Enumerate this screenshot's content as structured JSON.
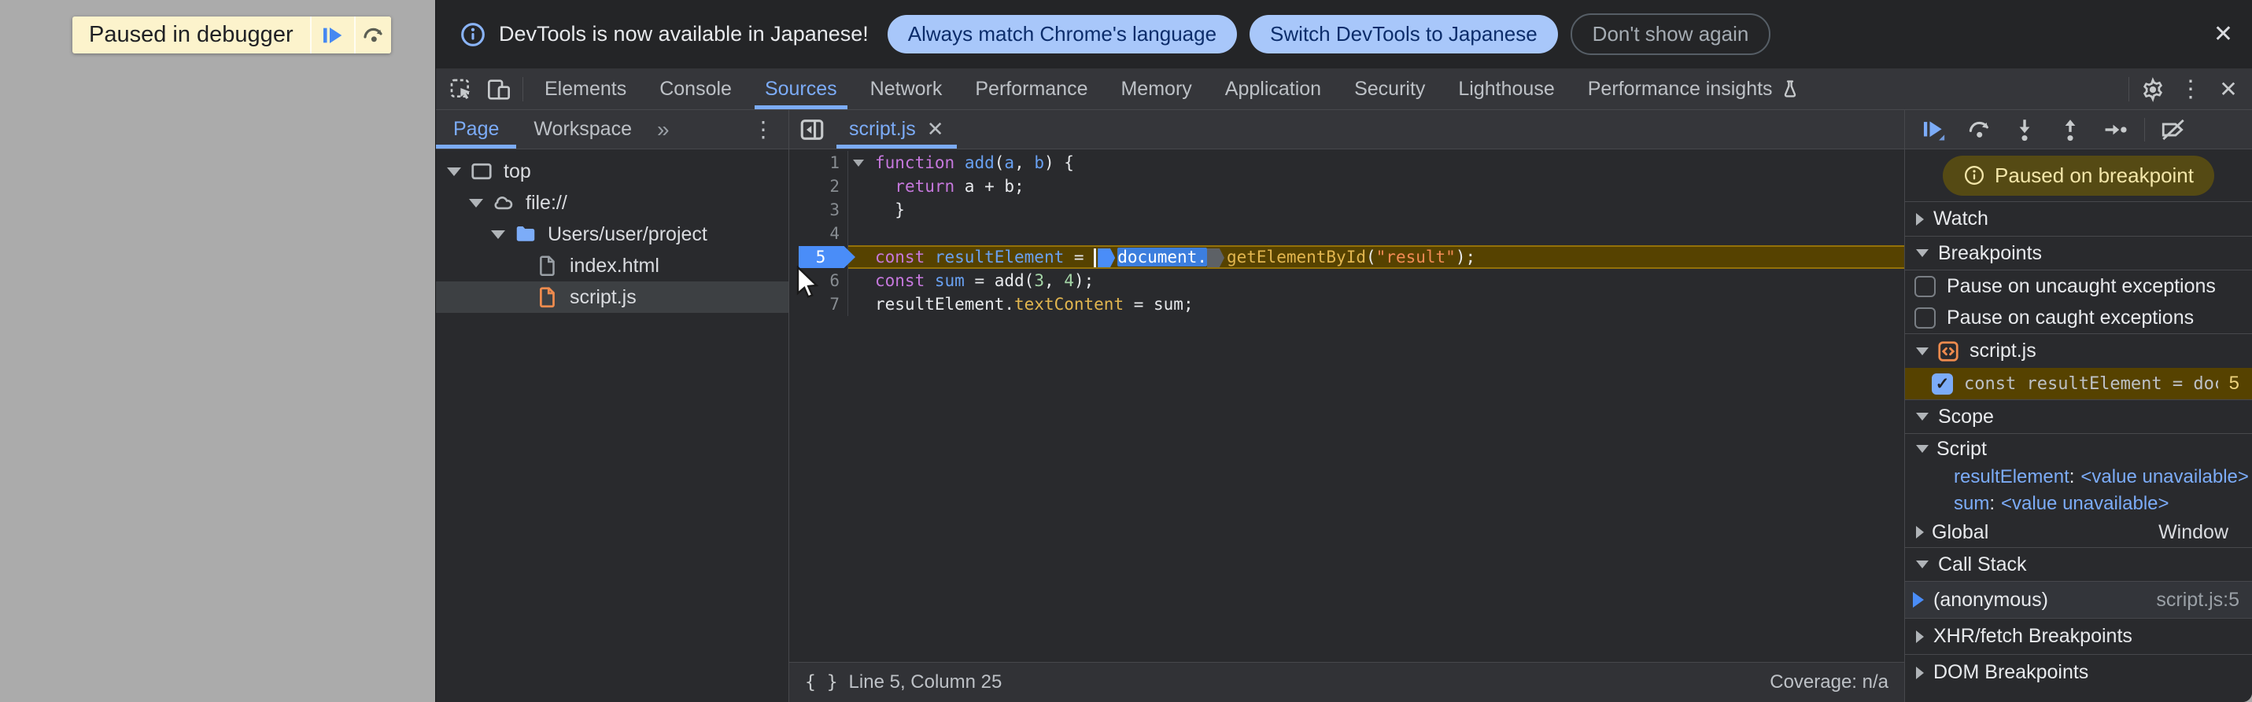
{
  "page_overlay": {
    "paused_label": "Paused in debugger"
  },
  "infobar": {
    "message": "DevTools is now available in Japanese!",
    "buttons": [
      {
        "label": "Always match Chrome's language",
        "style": "filled"
      },
      {
        "label": "Switch DevTools to Japanese",
        "style": "filled"
      },
      {
        "label": "Don't show again",
        "style": "outline"
      }
    ],
    "close_label": "✕"
  },
  "tabbar": {
    "tabs": [
      "Elements",
      "Console",
      "Sources",
      "Network",
      "Performance",
      "Memory",
      "Application",
      "Security",
      "Lighthouse",
      "Performance insights"
    ],
    "active": "Sources",
    "flask_tab": "Performance insights"
  },
  "navigator": {
    "tabs": [
      {
        "label": "Page",
        "active": true
      },
      {
        "label": "Workspace",
        "active": false
      }
    ],
    "more_symbol": "»",
    "kebab_symbol": "⋮",
    "tree": [
      {
        "label": "top",
        "icon": "frame",
        "depth": 0,
        "caret": "down"
      },
      {
        "label": "file://",
        "icon": "cloud",
        "depth": 1,
        "caret": "down"
      },
      {
        "label": "Users/user/project",
        "icon": "folder",
        "depth": 2,
        "caret": "down"
      },
      {
        "label": "index.html",
        "icon": "file",
        "depth": 3,
        "caret": "none"
      },
      {
        "label": "script.js",
        "icon": "file-js",
        "depth": 3,
        "caret": "none",
        "selected": true
      }
    ]
  },
  "editor": {
    "tab": "script.js",
    "tab_close": "✕",
    "current_line": 5,
    "lines": [
      {
        "n": 1,
        "fold": true,
        "tokens": [
          [
            "k",
            "function"
          ],
          [
            "v",
            " "
          ],
          [
            "d",
            "add"
          ],
          [
            "v",
            "("
          ],
          [
            "d",
            "a"
          ],
          [
            "v",
            ", "
          ],
          [
            "d",
            "b"
          ],
          [
            "v",
            ") {"
          ]
        ]
      },
      {
        "n": 2,
        "tokens": [
          [
            "v",
            "  "
          ],
          [
            "k",
            "return"
          ],
          [
            "v",
            " a + b;"
          ]
        ]
      },
      {
        "n": 3,
        "tokens": [
          [
            "v",
            "  }"
          ]
        ]
      },
      {
        "n": 4,
        "tokens": []
      },
      {
        "n": 5,
        "exec": true,
        "tokens": [
          [
            "k",
            "const"
          ],
          [
            "v",
            " "
          ],
          [
            "d",
            "resultElement"
          ],
          [
            "v",
            " = "
          ],
          [
            "caret",
            ""
          ],
          [
            "bp-on",
            ""
          ],
          [
            "sel",
            "document."
          ],
          [
            "bp-off",
            ""
          ],
          [
            "p",
            "getElementById"
          ],
          [
            "v",
            "("
          ],
          [
            "s",
            "\"result\""
          ],
          [
            "v",
            ");"
          ]
        ]
      },
      {
        "n": 6,
        "tokens": [
          [
            "k",
            "const"
          ],
          [
            "v",
            " "
          ],
          [
            "d",
            "sum"
          ],
          [
            "v",
            " = add("
          ],
          [
            "num",
            "3"
          ],
          [
            "v",
            ", "
          ],
          [
            "num",
            "4"
          ],
          [
            "v",
            ");"
          ]
        ]
      },
      {
        "n": 7,
        "tokens": [
          [
            "v",
            "resultElement."
          ],
          [
            "p",
            "textContent"
          ],
          [
            "v",
            " = sum;"
          ]
        ]
      }
    ],
    "status_left": "Line 5, Column 25",
    "status_braces": "{ }",
    "status_right": "Coverage: n/a"
  },
  "debugger": {
    "paused_badge": "Paused on breakpoint",
    "watch_label": "Watch",
    "breakpoints_label": "Breakpoints",
    "pause_uncaught": "Pause on uncaught exceptions",
    "pause_caught": "Pause on caught exceptions",
    "bp_file": "script.js",
    "bp_entry": {
      "text": "const resultElement = doc⋯",
      "line": "5",
      "checked": true
    },
    "scope_label": "Scope",
    "scope_script_label": "Script",
    "scope_vars": [
      {
        "key": "resultElement",
        "value": "<value unavailable>"
      },
      {
        "key": "sum",
        "value": "<value unavailable>"
      }
    ],
    "scope_global": {
      "label": "Global",
      "value": "Window"
    },
    "callstack_label": "Call Stack",
    "frames": [
      {
        "fn": "(anonymous)",
        "loc": "script.js:5"
      }
    ],
    "xhr_label": "XHR/fetch Breakpoints",
    "dom_label": "DOM Breakpoints"
  },
  "colors": {
    "accent_blue": "#7cacf8",
    "breakpoint_blue": "#4a8df8",
    "execution_line_bg": "#564200",
    "paused_badge_bg": "#554a14",
    "infobar_pill_bg": "#a8c7fa",
    "keyword": "#c678dd",
    "definition": "#69a1f2",
    "property": "#e2b64f",
    "string": "#f28b54",
    "number": "#a5d6a7",
    "page_bg": "#ababab"
  }
}
